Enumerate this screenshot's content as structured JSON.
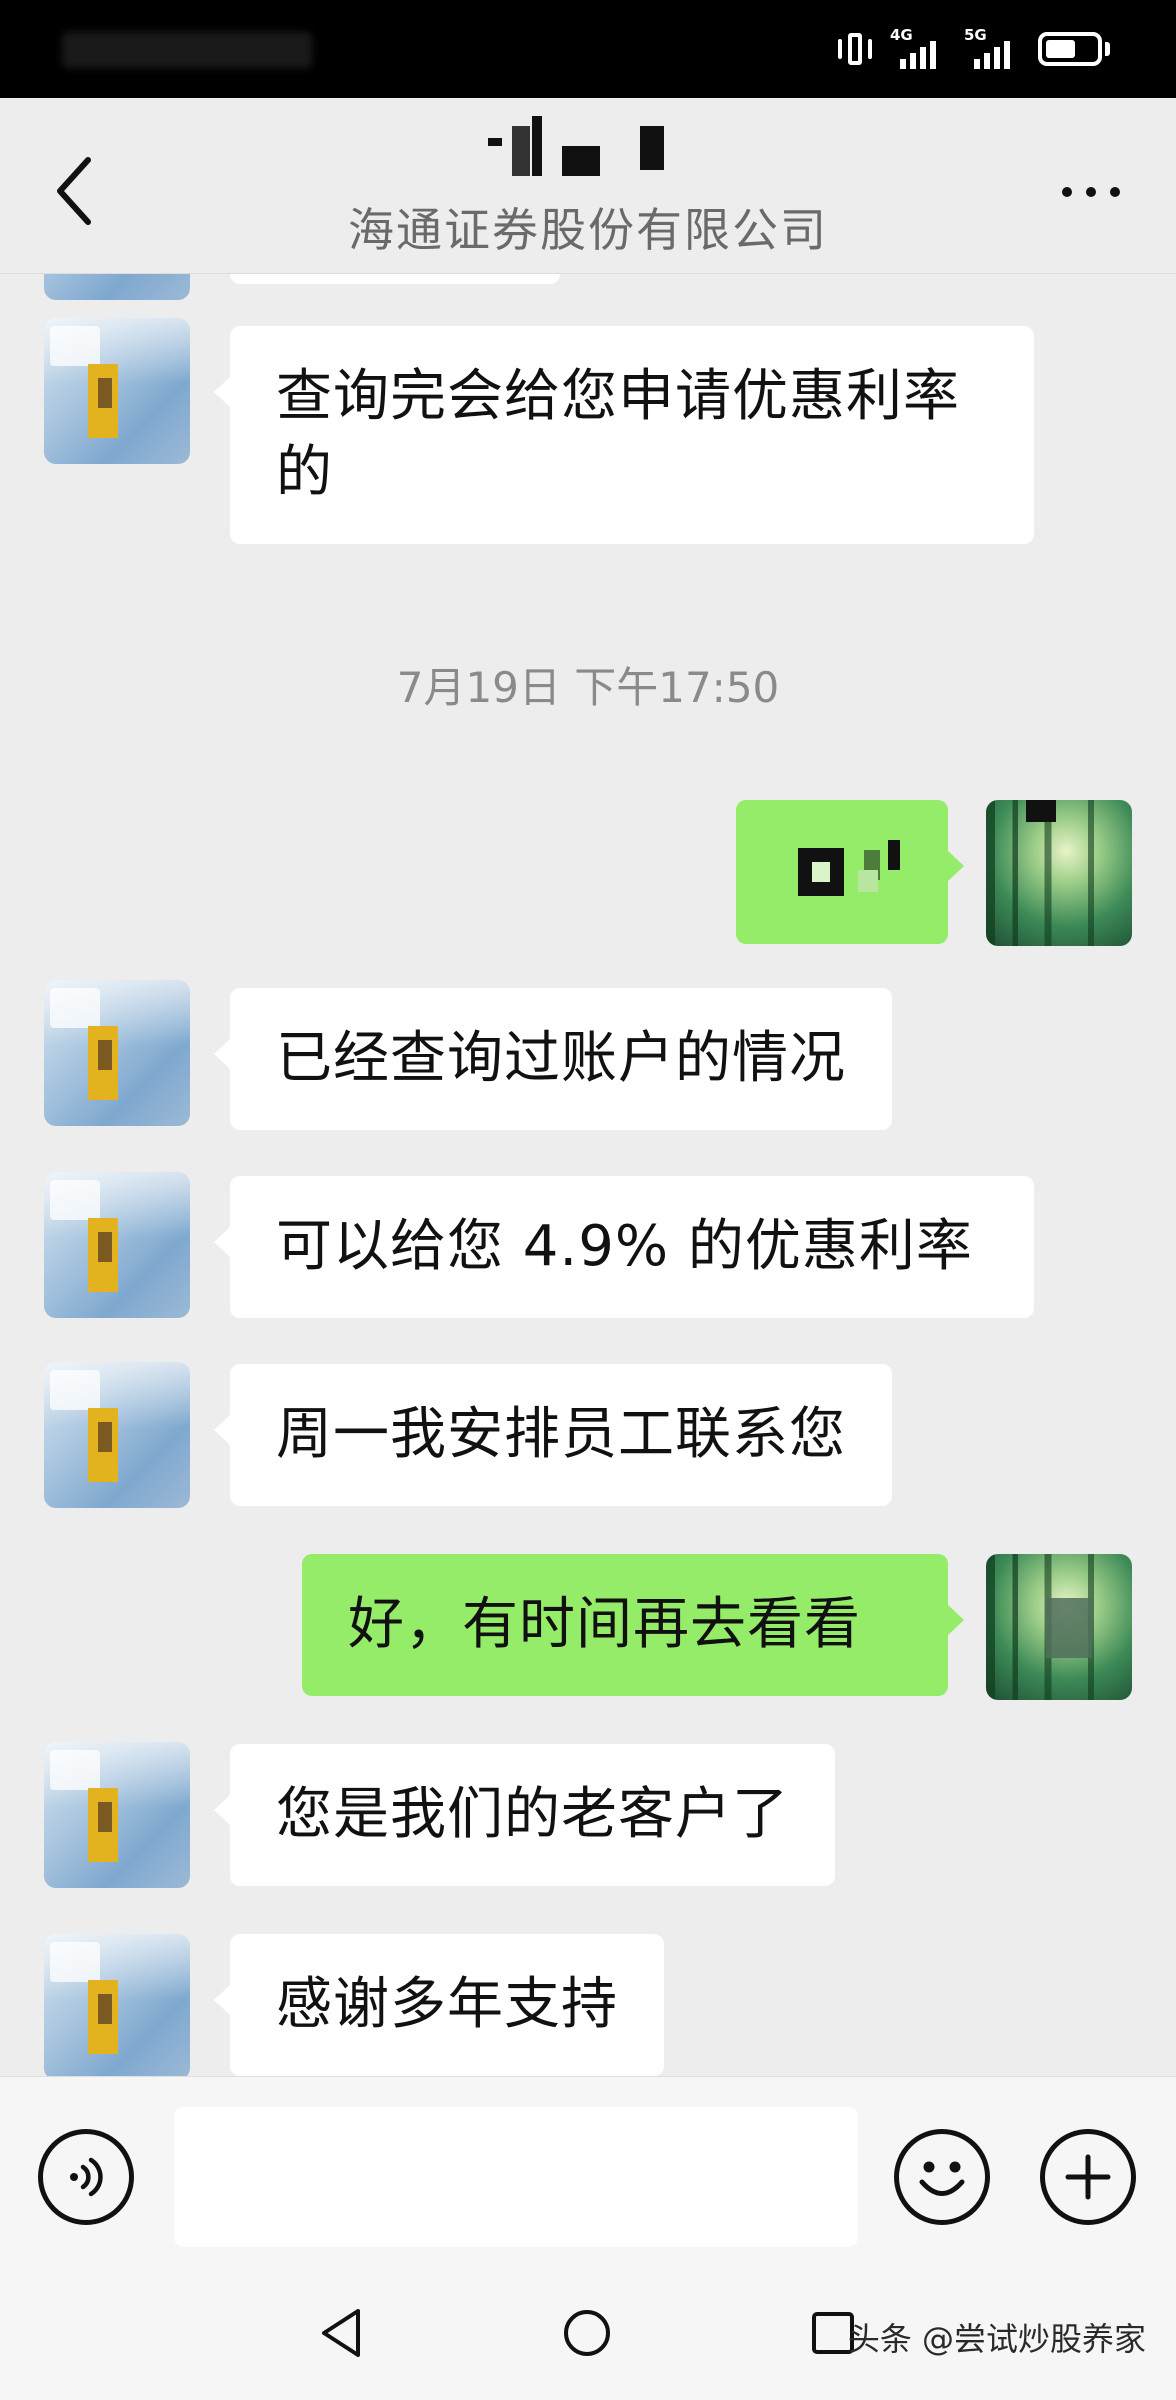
{
  "header": {
    "subtitle": "海通证券股份有限公司"
  },
  "messages": [
    {
      "from": "contact",
      "text": "查询完会给您申请优惠利率的"
    },
    {
      "type": "timestamp",
      "text": "7月19日 下午17:50"
    },
    {
      "from": "me",
      "text": ""
    },
    {
      "from": "contact",
      "text": "已经查询过账户的情况"
    },
    {
      "from": "contact",
      "text": "可以给您 4.9% 的优惠利率"
    },
    {
      "from": "contact",
      "text": "周一我安排员工联系您"
    },
    {
      "from": "me",
      "text": "好，有时间再去看看"
    },
    {
      "from": "contact",
      "text": "您是我们的老客户了"
    },
    {
      "from": "contact",
      "text": "感谢多年支持"
    }
  ],
  "input_bar": {
    "placeholder": "",
    "icons": [
      "voice-icon",
      "emoji-icon",
      "plus-icon"
    ]
  },
  "status_bar": {
    "network_labels": [
      "4G",
      "5G"
    ],
    "battery_level": 0.6
  },
  "watermark": "头条 @尝试炒股养家",
  "colors": {
    "my_bubble": "#95ec69",
    "contact_bubble": "#ffffff",
    "background": "#ededed"
  }
}
